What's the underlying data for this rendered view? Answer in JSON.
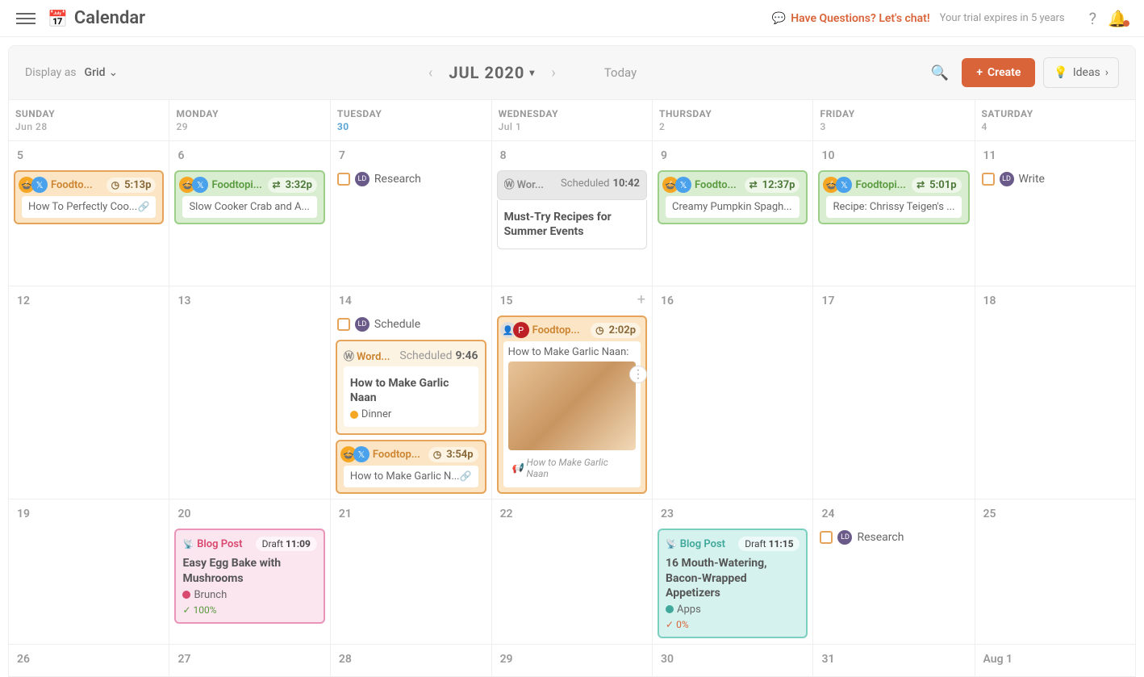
{
  "header": {
    "title": "Calendar",
    "chat_link": "Have Questions? Let's chat!",
    "trial": "Your trial expires in 5 years"
  },
  "toolbar": {
    "display_label": "Display as",
    "display_value": "Grid",
    "month": "JUL 2020",
    "today": "Today",
    "create": "Create",
    "ideas": "Ideas"
  },
  "dayHeaders": [
    {
      "name": "SUNDAY",
      "sub": "Jun 28"
    },
    {
      "name": "MONDAY",
      "sub": "29"
    },
    {
      "name": "TUESDAY",
      "sub": "30",
      "today": true
    },
    {
      "name": "WEDNESDAY",
      "sub": "Jul 1"
    },
    {
      "name": "THURSDAY",
      "sub": "2"
    },
    {
      "name": "FRIDAY",
      "sub": "3"
    },
    {
      "name": "SATURDAY",
      "sub": "4"
    }
  ],
  "week1": {
    "d5": {
      "date": "5",
      "social": {
        "brand": "Foodto...",
        "time": "5:13p",
        "sub": "How To Perfectly Coo..."
      }
    },
    "d6": {
      "date": "6",
      "social": {
        "brand": "Foodtopi...",
        "time": "3:32p",
        "sub": "Slow Cooker Crab and A..."
      }
    },
    "d7": {
      "date": "7",
      "task": "Research"
    },
    "d8": {
      "date": "8",
      "wp": {
        "brand": "Wor...",
        "status": "Scheduled",
        "time": "10:42",
        "title": "Must-Try Recipes for Summer Events"
      }
    },
    "d9": {
      "date": "9",
      "social": {
        "brand": "Foodto...",
        "time": "12:37p",
        "sub": "Creamy Pumpkin Spagh..."
      }
    },
    "d10": {
      "date": "10",
      "social": {
        "brand": "Foodtopi...",
        "time": "5:01p",
        "sub": "Recipe: Chrissy Teigen's ..."
      }
    },
    "d11": {
      "date": "11",
      "task": "Write"
    }
  },
  "week2": {
    "d12": {
      "date": "12"
    },
    "d13": {
      "date": "13"
    },
    "d14": {
      "date": "14",
      "task": "Schedule",
      "wp": {
        "brand": "Word...",
        "status": "Scheduled",
        "time": "9:46",
        "title": "How to Make Garlic Naan",
        "tag": "Dinner"
      },
      "social": {
        "brand": "Foodtop...",
        "time": "3:54p",
        "sub": "How to Make Garlic N..."
      }
    },
    "d15": {
      "date": "15",
      "social": {
        "brand": "Foodtop...",
        "time": "2:02p",
        "text": "How to Make Garlic Naan:",
        "foot": "How to Make Garlic Naan"
      }
    },
    "d16": {
      "date": "16"
    },
    "d17": {
      "date": "17"
    },
    "d18": {
      "date": "18"
    }
  },
  "week3": {
    "d19": {
      "date": "19"
    },
    "d20": {
      "date": "20",
      "blog": {
        "type": "Blog Post",
        "status": "Draft",
        "time": "11:09",
        "title": "Easy Egg Bake with Mushrooms",
        "tag": "Brunch",
        "prog": "100%"
      }
    },
    "d21": {
      "date": "21"
    },
    "d22": {
      "date": "22"
    },
    "d23": {
      "date": "23",
      "blog": {
        "type": "Blog Post",
        "status": "Draft",
        "time": "11:15",
        "title": "16 Mouth-Watering, Bacon-Wrapped Appetizers",
        "tag": "Apps",
        "prog": "0%"
      }
    },
    "d24": {
      "date": "24",
      "task": "Research"
    },
    "d25": {
      "date": "25"
    }
  },
  "week4": {
    "d26": "26",
    "d27": "27",
    "d28": "28",
    "d29": "29",
    "d30": "30",
    "d31": "31",
    "daug1": "Aug 1"
  }
}
